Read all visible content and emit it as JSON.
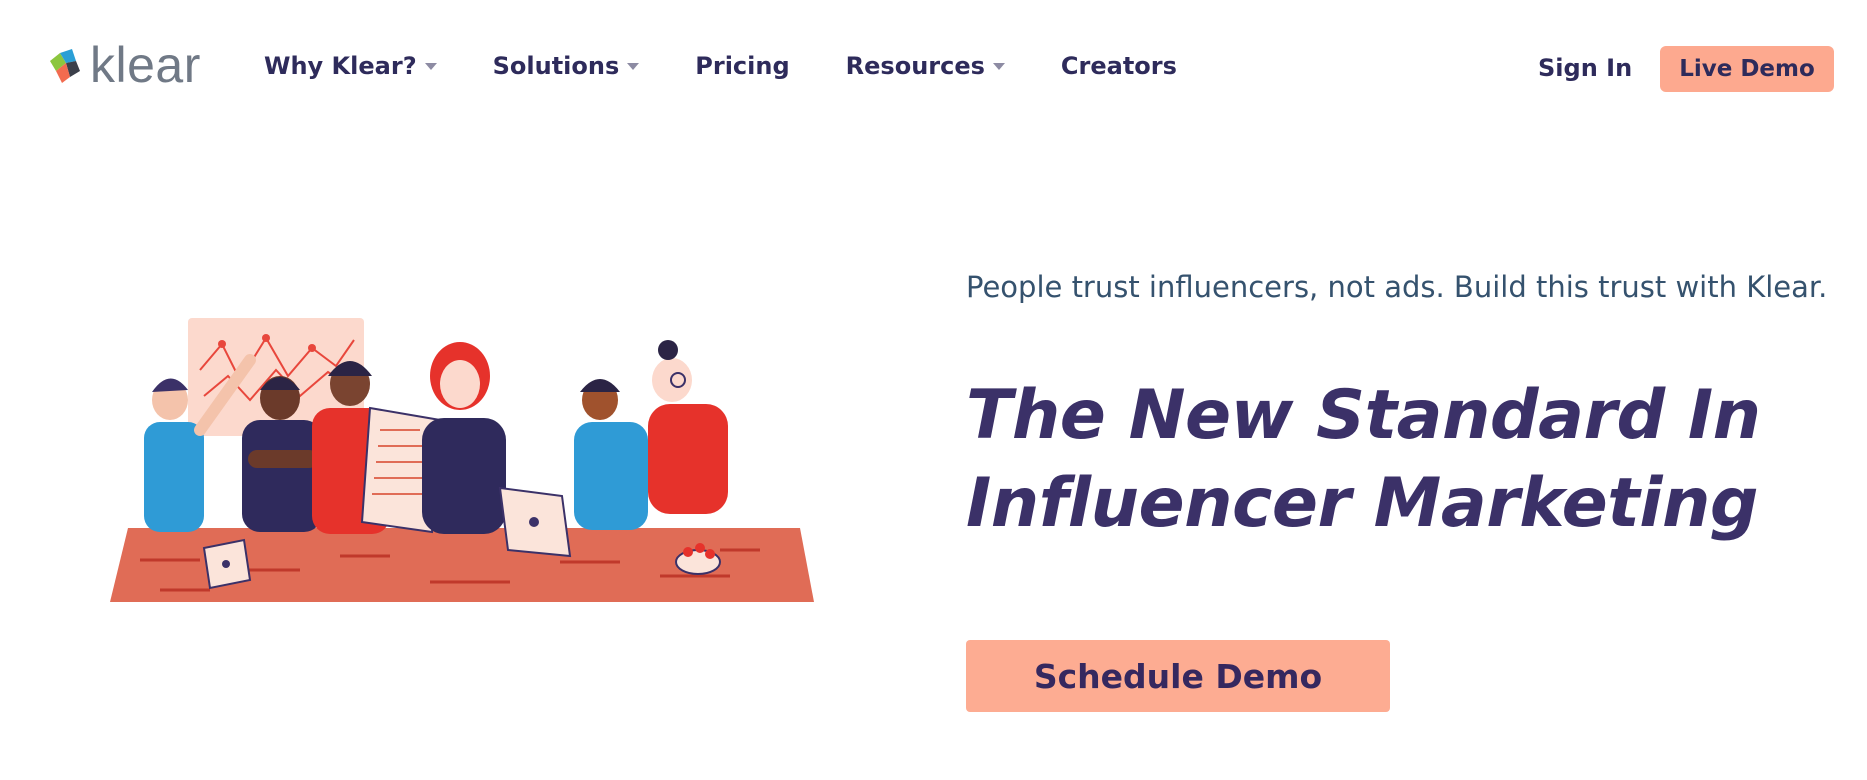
{
  "header": {
    "logo_text": "klear",
    "nav": [
      {
        "label": "Why Klear?",
        "has_dropdown": true
      },
      {
        "label": "Solutions",
        "has_dropdown": true
      },
      {
        "label": "Pricing",
        "has_dropdown": false
      },
      {
        "label": "Resources",
        "has_dropdown": true
      },
      {
        "label": "Creators",
        "has_dropdown": false
      }
    ],
    "sign_in": "Sign In",
    "live_demo": "Live Demo"
  },
  "hero": {
    "tagline": "People trust influencers, not ads. Build this trust with Klear.",
    "headline_line1": "The New Standard In",
    "headline_line2": "Influencer Marketing",
    "cta": "Schedule Demo",
    "illustration": "team-meeting-illustration"
  },
  "colors": {
    "accent": "#fda98f",
    "headline": "#3b3168",
    "nav_text": "#2e2b5b",
    "tagline": "#35526e"
  }
}
